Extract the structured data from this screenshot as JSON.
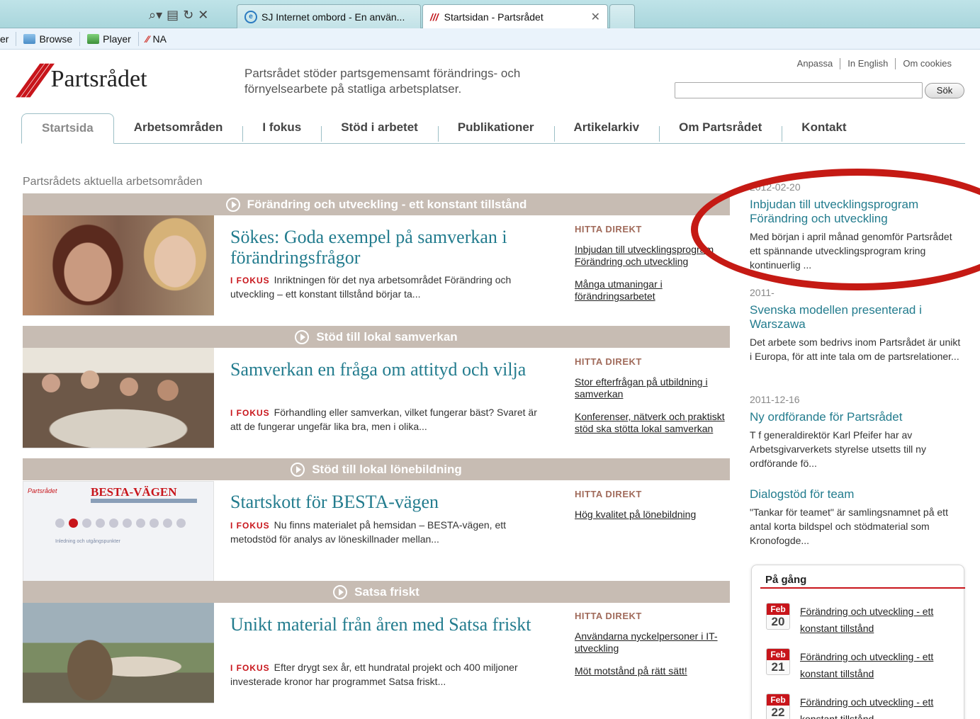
{
  "browser": {
    "tabs": [
      {
        "label": "SJ Internet ombord - En använ..."
      },
      {
        "label": "Startsidan - Partsrådet"
      }
    ],
    "favorites": [
      {
        "label": "er"
      },
      {
        "label": "Browse"
      },
      {
        "label": "Player"
      },
      {
        "label": "NA"
      }
    ]
  },
  "site": {
    "logo_text": "Partsrådet",
    "tagline": "Partsrådet stöder partsgemensamt förändrings- och förnyelsearbete på statliga arbetsplatser.",
    "toplinks": [
      "Anpassa",
      "In English",
      "Om cookies"
    ],
    "search": {
      "value": "",
      "button": "Sök"
    }
  },
  "nav": [
    "Startsida",
    "Arbetsområden",
    "I fokus",
    "Stöd i arbetet",
    "Publikationer",
    "Artikelarkiv",
    "Om Partsrådet",
    "Kontakt"
  ],
  "main": {
    "heading": "Partsrådets aktuella arbetsområden",
    "fokus_label": "I FOKUS",
    "hitta_label": "HITTA DIREKT",
    "sections": [
      {
        "band": "Förändring och utveckling - ett konstant tillstånd",
        "title": "Sökes: Goda exempel på samverkan i förändringsfrågor",
        "body": "Inriktningen för det nya arbetsområdet Förändring och utveckling – ett konstant tillstånd börjar ta...",
        "links": [
          "Inbjudan till utvecklingsprogram Förändring och utveckling",
          "Många utmaningar i förändringsarbetet"
        ]
      },
      {
        "band": "Stöd till lokal samverkan",
        "title": "Samverkan en fråga om attityd och vilja",
        "body": "Förhandling eller samverkan, vilket fungerar bäst? Svaret är att de fungerar ungefär lika bra, men i olika...",
        "links": [
          "Stor efterfrågan på utbildning i samverkan",
          "Konferenser, nätverk och praktiskt stöd ska stötta lokal samverkan"
        ]
      },
      {
        "band": "Stöd till lokal lönebildning",
        "title": "Startskott för BESTA-vägen",
        "body": "Nu finns materialet på hemsidan – BESTA-vägen, ett metodstöd för analys av löneskillnader mellan...",
        "links": [
          "Hög kvalitet på lönebildning"
        ],
        "image": {
          "logo": "Partsrådet",
          "title": "BESTA-VÄGEN",
          "text": "Inledning och utgångspunkter"
        }
      },
      {
        "band": "Satsa friskt",
        "title": "Unikt material från åren med Satsa friskt",
        "body": "Efter drygt sex år, ett hundratal projekt och 400 miljoner investerade kronor har programmet Satsa friskt...",
        "links": [
          "Användarna nyckelpersoner i IT-utveckling",
          "Möt motstånd på rätt sätt!"
        ]
      }
    ]
  },
  "news": [
    {
      "date": "2012-02-20",
      "title": "Inbjudan till utvecklingsprogram Förändring och utveckling",
      "desc": "Med början i april månad genomför Partsrådet ett spännande utvecklingsprogram kring kontinuerlig ..."
    },
    {
      "date": "2011-",
      "title": "Svenska modellen presenterad i Warszawa",
      "desc": "Det arbete som bedrivs inom Partsrådet är unikt i Europa, för att inte tala om de partsrelationer..."
    },
    {
      "date": "2011-12-16",
      "title": "Ny ordförande för Partsrådet",
      "desc": "T f generaldirektör Karl Pfeifer har av Arbetsgivarverkets styrelse utsetts till ny ordförande fö..."
    },
    {
      "date": "",
      "title": "Dialogstöd för team",
      "desc": "\"Tankar för teamet\" är samlingsnamnet på ett antal korta bildspel och stödmaterial som Kronofogde..."
    }
  ],
  "pagang": {
    "heading": "På gång",
    "events": [
      {
        "month": "Feb",
        "day": "20",
        "title": "Förändring och utveckling - ett konstant tillstånd"
      },
      {
        "month": "Feb",
        "day": "21",
        "title": "Förändring och utveckling - ett konstant tillstånd"
      },
      {
        "month": "Feb",
        "day": "22",
        "title": "Förändring och utveckling - ett konstant tillstånd"
      }
    ]
  },
  "colors": {
    "brand_red": "#c8151b",
    "link_teal": "#237c8e",
    "band": "#c7bcb3",
    "annotation_red": "#c51a14"
  }
}
